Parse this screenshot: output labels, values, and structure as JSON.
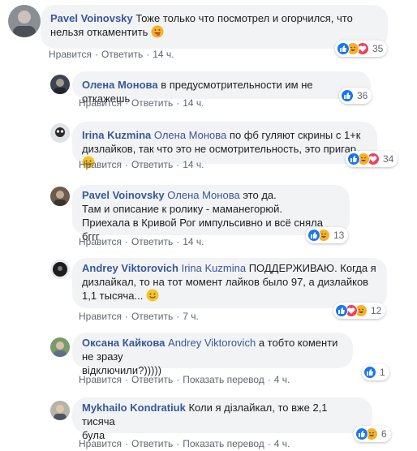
{
  "comments": [
    {
      "author": "Pavel Voinovsky",
      "text_line1": "Тоже только что посмотрел и огорчился, что",
      "text_line2": "нельзя откаментить",
      "like": "Нравится",
      "reply": "Ответить",
      "time": "14 ч.",
      "reactions": [
        "like",
        "haha",
        "love"
      ],
      "count": "35"
    },
    {
      "author": "Олена Монова",
      "text_line1": "в предусмотрительности им не откажешь",
      "like": "Нравится",
      "reply": "Ответить",
      "time": "14 ч.",
      "reactions": [
        "like"
      ],
      "count": "36"
    },
    {
      "author": "Irina Kuzmina",
      "mention": "Олена Монова",
      "text_line1": "по фб гуляют скрины с 1+к",
      "text_line2": "дизлайков, так что это не осмотрительность, это пригар",
      "like": "Нравится",
      "reply": "Ответить",
      "time": "14 ч.",
      "reactions": [
        "like",
        "haha",
        "love"
      ],
      "count": "34"
    },
    {
      "author": "Pavel Voinovsky",
      "mention": "Олена Монова",
      "text_line1": "это да.",
      "text_line2": "Там и описание к ролику - маманегорюй.",
      "text_line3": "Приехала в Кривой Рог импульсивно и всё сняла бггг",
      "like": "Нравится",
      "reply": "Ответить",
      "time": "14 ч.",
      "reactions": [
        "like",
        "haha"
      ],
      "count": "13"
    },
    {
      "author": "Andrey Viktorovich",
      "mention": "Irina Kuzmina",
      "text_line1": "ПОДДЕРЖИВАЮ. Когда я",
      "text_line2": "дизлайкал, то на тот момент лайков было 97, а дизлайков",
      "text_line3": "1,1 тысяча...",
      "like": "Нравится",
      "reply": "Ответить",
      "time": "7 ч.",
      "reactions": [
        "like",
        "love",
        "haha"
      ],
      "count": "12"
    },
    {
      "author": "Оксана Кайкова",
      "mention": "Andrey Viktorovich",
      "text_line1": "а тобто коменти не зразу",
      "text_line2": "відключили?)))))",
      "like": "Нравится",
      "reply": "Ответить",
      "translate": "Показать перевод",
      "time": "4 ч.",
      "reactions": [
        "like"
      ],
      "count": "1"
    },
    {
      "author": "Mykhailo Kondratiuk",
      "text_line1": "Коли я дізлайкал, то вже 2,1 тисяча",
      "text_line2": "була",
      "like": "Нравится",
      "reply": "Ответить",
      "translate": "Показать перевод",
      "time": "4 ч.",
      "reactions": [
        "like",
        "haha"
      ],
      "count": "6"
    }
  ],
  "colors": {
    "author": "#385898",
    "bubble": "#f2f3f5",
    "meta": "#606770",
    "like": "#1877f2",
    "love": "#f33e58",
    "haha": "#f7b125"
  }
}
